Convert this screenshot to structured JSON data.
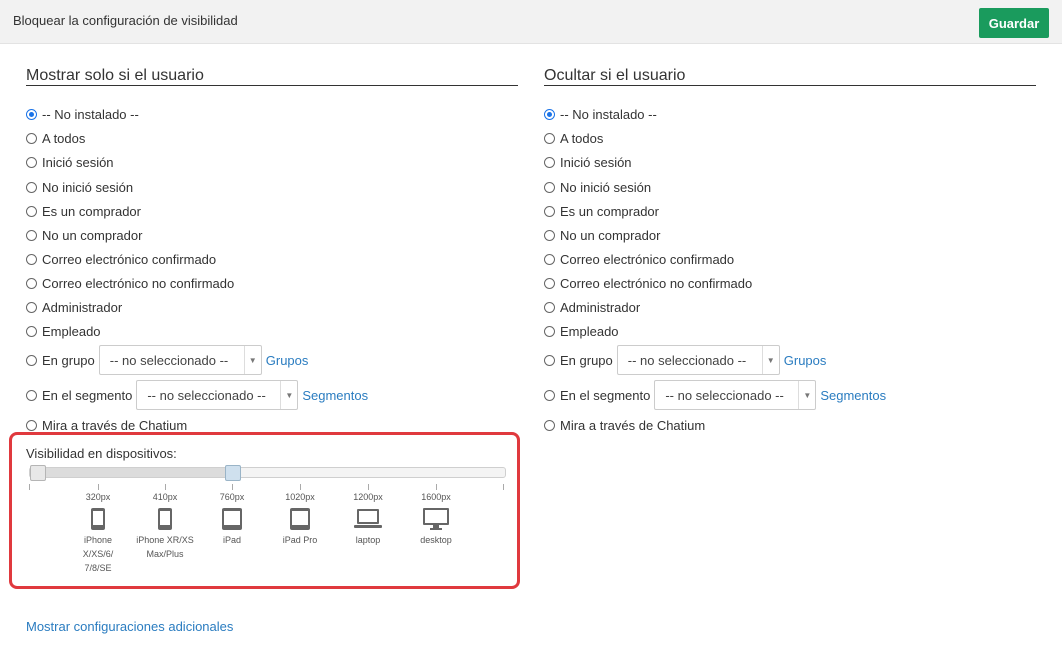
{
  "header": {
    "title": "Bloquear la configuración de visibilidad",
    "save_label": "Guardar"
  },
  "show_if": {
    "heading": "Mostrar solo si el usuario",
    "options": [
      "-- No instalado --",
      "A todos",
      "Inició sesión",
      "No inició sesión",
      "Es un comprador",
      "No un comprador",
      "Correo electrónico confirmado",
      "Correo electrónico no confirmado",
      "Administrador",
      "Empleado",
      "En grupo",
      "En el segmento",
      "Mira a través de Chatium"
    ],
    "selected": "-- No instalado --",
    "group_select": "-- no seleccionado --",
    "group_link": "Grupos",
    "segment_select": "-- no seleccionado --",
    "segment_link": "Segmentos"
  },
  "hide_if": {
    "heading": "Ocultar si el usuario",
    "options": [
      "-- No instalado --",
      "A todos",
      "Inició sesión",
      "No inició sesión",
      "Es un comprador",
      "No un comprador",
      "Correo electrónico confirmado",
      "Correo electrónico no confirmado",
      "Administrador",
      "Empleado",
      "En grupo",
      "En el segmento",
      "Mira a través de Chatium"
    ],
    "selected": "-- No instalado --",
    "group_select": "-- no seleccionado --",
    "group_link": "Grupos",
    "segment_select": "-- no seleccionado --",
    "segment_link": "Segmentos"
  },
  "devices": {
    "label": "Visibilidad en dispositivos:",
    "range_selected": {
      "from_device": 0,
      "to_device": 2
    },
    "items": [
      {
        "px": "320px",
        "name": "iPhone X/XS/6/ 7/8/SE",
        "icon": "phone-icon"
      },
      {
        "px": "410px",
        "name": "iPhone XR/XS Max/Plus",
        "icon": "phone-icon"
      },
      {
        "px": "760px",
        "name": "iPad",
        "icon": "tablet-icon"
      },
      {
        "px": "1020px",
        "name": "iPad Pro",
        "icon": "tablet-icon"
      },
      {
        "px": "1200px",
        "name": "laptop",
        "icon": "laptop-icon"
      },
      {
        "px": "1600px",
        "name": "desktop",
        "icon": "desktop-icon"
      }
    ]
  },
  "footer": {
    "more_settings": "Mostrar configuraciones adicionales"
  },
  "colors": {
    "accent": "#1a9b5d",
    "link": "#2a7cc0",
    "highlight_border": "#e0393e",
    "radio_selected": "#1a73e8"
  }
}
